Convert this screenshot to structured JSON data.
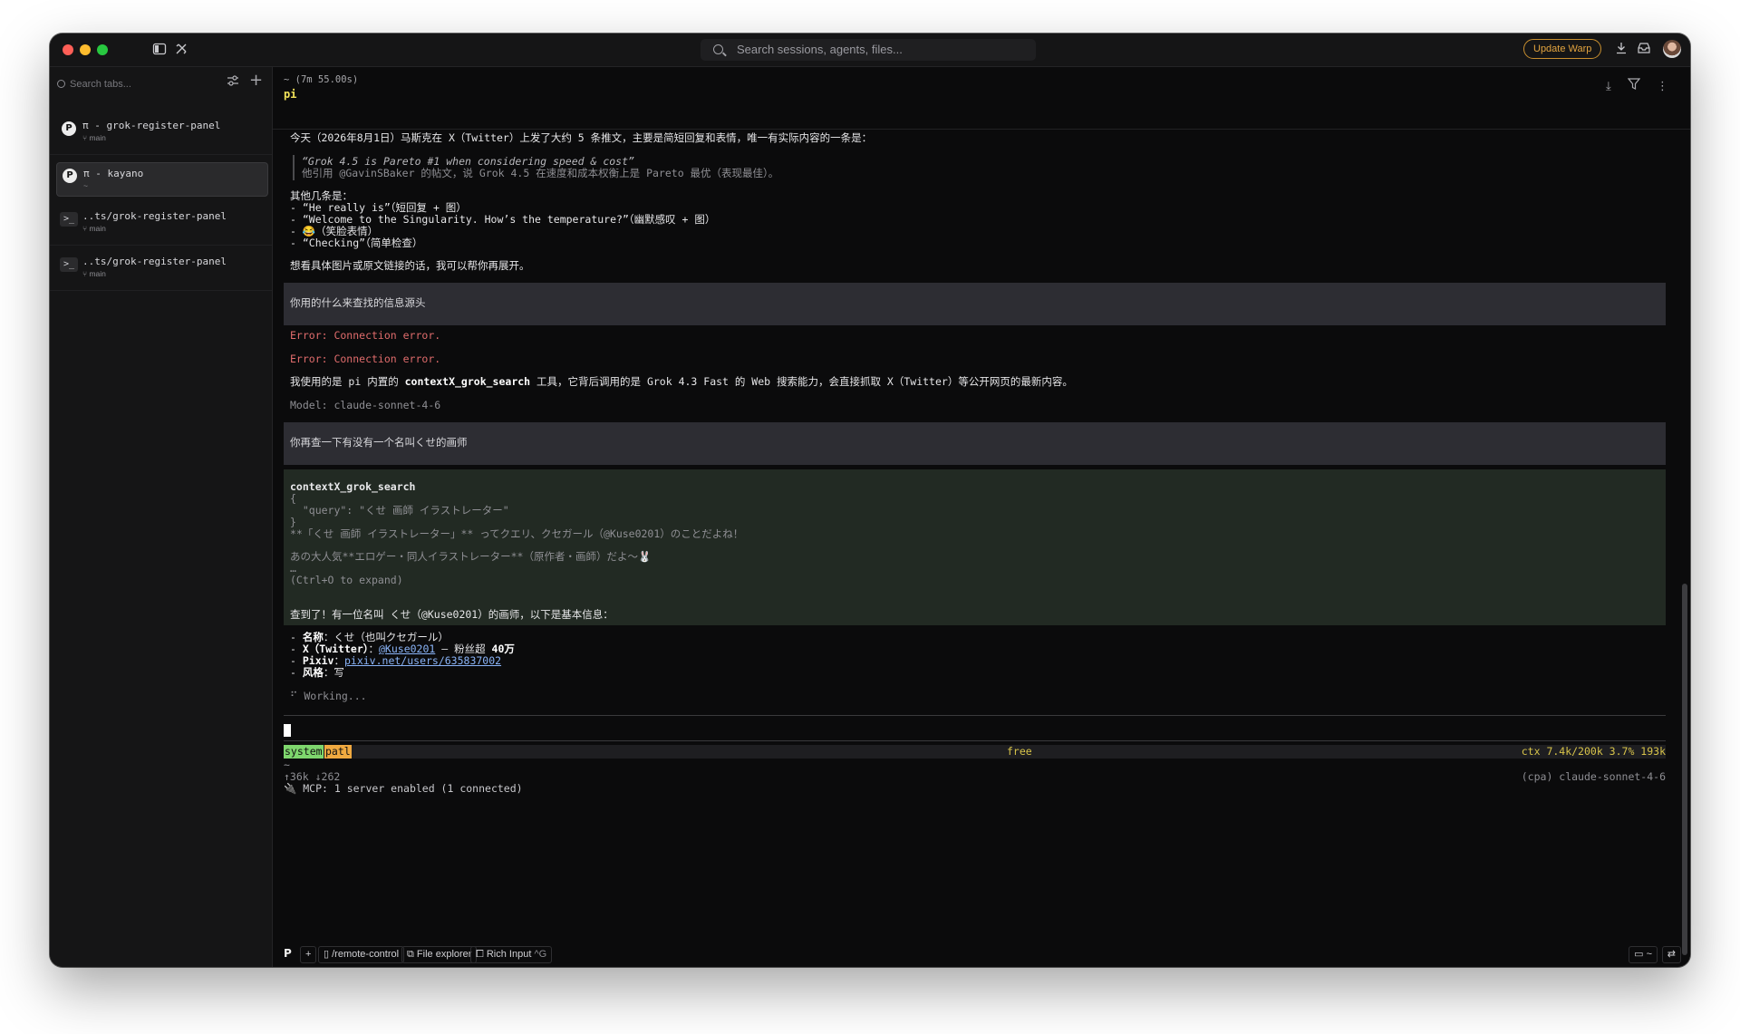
{
  "titlebar": {
    "search_placeholder": "Search sessions, agents, files...",
    "update_label": "Update Warp",
    "icons": [
      "sidebar-toggle-icon",
      "tools-icon",
      "download-icon",
      "inbox-icon",
      "avatar"
    ]
  },
  "sidebar": {
    "search_placeholder": "Search tabs...",
    "tabs": [
      {
        "title": "π - grok-register-panel",
        "sub": "⑂ main",
        "icon": "pi-badge"
      },
      {
        "title": "π - kayano",
        "sub": "~",
        "icon": "pi-badge"
      },
      {
        "title": "..ts/grok-register-panel",
        "sub": "⑂ main",
        "icon": "terminal-icon"
      },
      {
        "title": "..ts/grok-register-panel",
        "sub": "⑂ main",
        "icon": "terminal-icon"
      }
    ]
  },
  "main": {
    "header_time": "~ (7m 55.00s)",
    "header_cmd": "pi",
    "lines": {
      "l1": "今天（2026年8月1日）马斯克在 X（Twitter）上发了大约 5 条推文，主要是简短回复和表情，唯一有实际内容的一条是：",
      "q1": "“Grok 4.5 is Pareto #1 when considering speed & cost”",
      "q2": "他引用 @GavinSBaker 的帖文，说 Grok 4.5 在速度和成本权衡上是 Pareto 最优（表现最佳）。",
      "l2": "其他几条是：",
      "l3": "- “He really is”（短回复 + 图）",
      "l4": "- “Welcome to the Singularity. How’s the temperature?”（幽默感叹 + 图）",
      "l5": "- 😂（笑脸表情）",
      "l6": "- “Checking”（简单检查）",
      "l7": "想看具体图片或原文链接的话，我可以帮你再展开。",
      "user1": "你用的什么来查找的信息源头",
      "err1": "Error: Connection error.",
      "err2": "Error: Connection error.",
      "l8a": "我使用的是 pi 内置的 ",
      "l8b": "contextX_grok_search",
      "l8c": " 工具，它背后调用的是 Grok 4.3 Fast 的 Web 搜索能力，会直接抓取 X（Twitter）等公开网页的最新内容。",
      "model": "Model: claude-sonnet-4-6",
      "user2": "你再查一下有没有一个名叫くせ的画师",
      "tool_name": "contextX_grok_search",
      "tool_j1": "{",
      "tool_j2": "  \"query\": \"くせ 画師 イラストレーター\"",
      "tool_j3": "}",
      "tool_r1": "**「くせ 画師 イラストレーター」** ってクエリ、クセガール（@Kuse0201）のことだよね！",
      "tool_r2": "あの大人気**エロゲー・同人イラストレーター**（原作者・画師）だよ〜🐰",
      "tool_r3": "…",
      "tool_r4": "(Ctrl+O to expand)",
      "l9": "查到了！有一位名叫 くせ（@Kuse0201）的画师，以下是基本信息：",
      "f1a": "- ",
      "f1b": "名称",
      "f1c": "：くせ（也叫クセガール）",
      "f2a": "- ",
      "f2b": "X（Twitter）",
      "f2c": "：",
      "f2d": "@Kuse0201",
      "f2e": " — 粉丝超 ",
      "f2f": "40万",
      "f3a": "- ",
      "f3b": "Pixiv",
      "f3c": "：",
      "f3d": "pixiv.net/users/635837002",
      "f4a": "- ",
      "f4b": "风格",
      "f4c": "：写",
      "working": "⠋ Working..."
    },
    "status": {
      "system": "system",
      "patl": "patl",
      "free": "free",
      "ctx": "ctx 7.4k/200k 3.7% 193k",
      "tilde": "~",
      "tokens": "↑36k ↓262",
      "mcp": "🔌 MCP: 1 server enabled (1 connected)",
      "model_right": "(cpa) claude-sonnet-4-6"
    },
    "bottom": {
      "plus": "+",
      "remote": "/remote-control",
      "files": "File explorer",
      "rich": "Rich Input",
      "rich_kbd": "^G",
      "folder": "~"
    }
  }
}
